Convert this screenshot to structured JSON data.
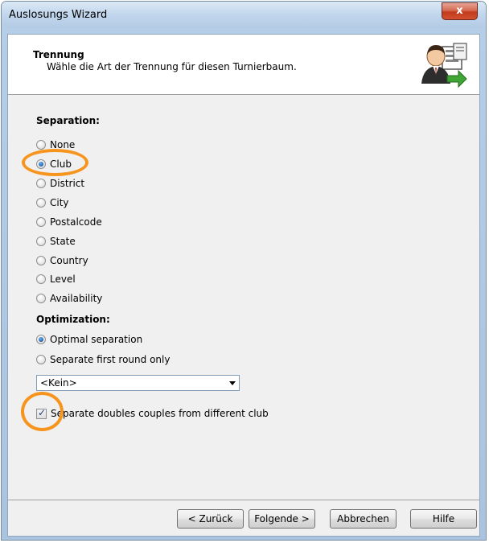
{
  "window": {
    "title": "Auslosungs Wizard",
    "close_label": "x"
  },
  "header": {
    "title": "Trennung",
    "subtitle": "Wähle die Art der Trennung für diesen Turnierbaum.",
    "icon": "wizard-user-icon"
  },
  "separation": {
    "label": "Separation:",
    "selected": "Club",
    "options": [
      "None",
      "Club",
      "District",
      "City",
      "Postalcode",
      "State",
      "Country",
      "Level",
      "Availability"
    ]
  },
  "optimization": {
    "label": "Optimization:",
    "selected": "Optimal separation",
    "options": [
      "Optimal separation",
      "Separate first round only"
    ]
  },
  "combo": {
    "value": "<Kein>"
  },
  "doubles_checkbox": {
    "label": "Separate doubles couples from different club",
    "checked": true
  },
  "buttons": {
    "back": "< Zurück",
    "next": "Folgende >",
    "cancel": "Abbrechen",
    "help": "Hilfe"
  },
  "colors": {
    "annotation": "#f7941d",
    "radio_selected": "#1d5fa8"
  }
}
